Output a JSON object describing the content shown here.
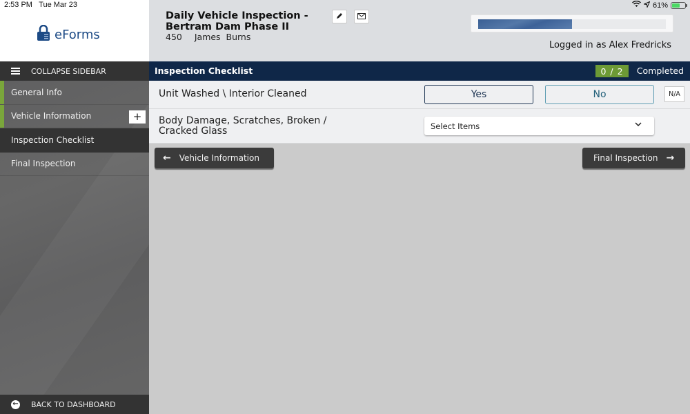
{
  "status_bar": {
    "time": "2:53 PM",
    "date": "Tue Mar 23",
    "battery_percent": "61%",
    "battery_level": 0.61,
    "icons": [
      "wifi-icon",
      "location-icon",
      "battery-charging-icon"
    ]
  },
  "logo": {
    "text": "eForms",
    "icon": "padlock-icon",
    "brand_color": "#1c4a85"
  },
  "header": {
    "title": "Daily Vehicle Inspection - Bertram Dam Phase II",
    "unit_number": "450",
    "employee_name": "James  Burns",
    "edit_icon": "pencil-icon",
    "email_icon": "envelope-icon",
    "progress_fraction": 0.5,
    "logged_in_text": "Logged in as Alex Fredricks"
  },
  "sidebar": {
    "collapse_label": "COLLAPSE SIDEBAR",
    "items": [
      {
        "label": "General Info",
        "state": "completed"
      },
      {
        "label": "Vehicle Information",
        "state": "completed",
        "add_button": "+"
      },
      {
        "label": "Inspection Checklist",
        "state": "active"
      },
      {
        "label": "Final Inspection",
        "state": "default"
      }
    ],
    "back_label": "BACK TO DASHBOARD",
    "completed_color": "#7aa63b"
  },
  "section": {
    "title": "Inspection Checklist",
    "count": "0 / 2",
    "count_suffix": "Completed",
    "bar_color": "#0f2748",
    "badge_color": "#6d9a35"
  },
  "questions": [
    {
      "label": "Unit Washed \\ Interior Cleaned",
      "type": "yes_no",
      "options": [
        "Yes",
        "No"
      ],
      "na_label": "N/A"
    },
    {
      "label": "Body Damage, Scratches, Broken / Cracked Glass",
      "type": "multi_select",
      "placeholder": "Select Items"
    }
  ],
  "navigation": {
    "prev_label": "Vehicle Information",
    "next_label": "Final Inspection"
  }
}
